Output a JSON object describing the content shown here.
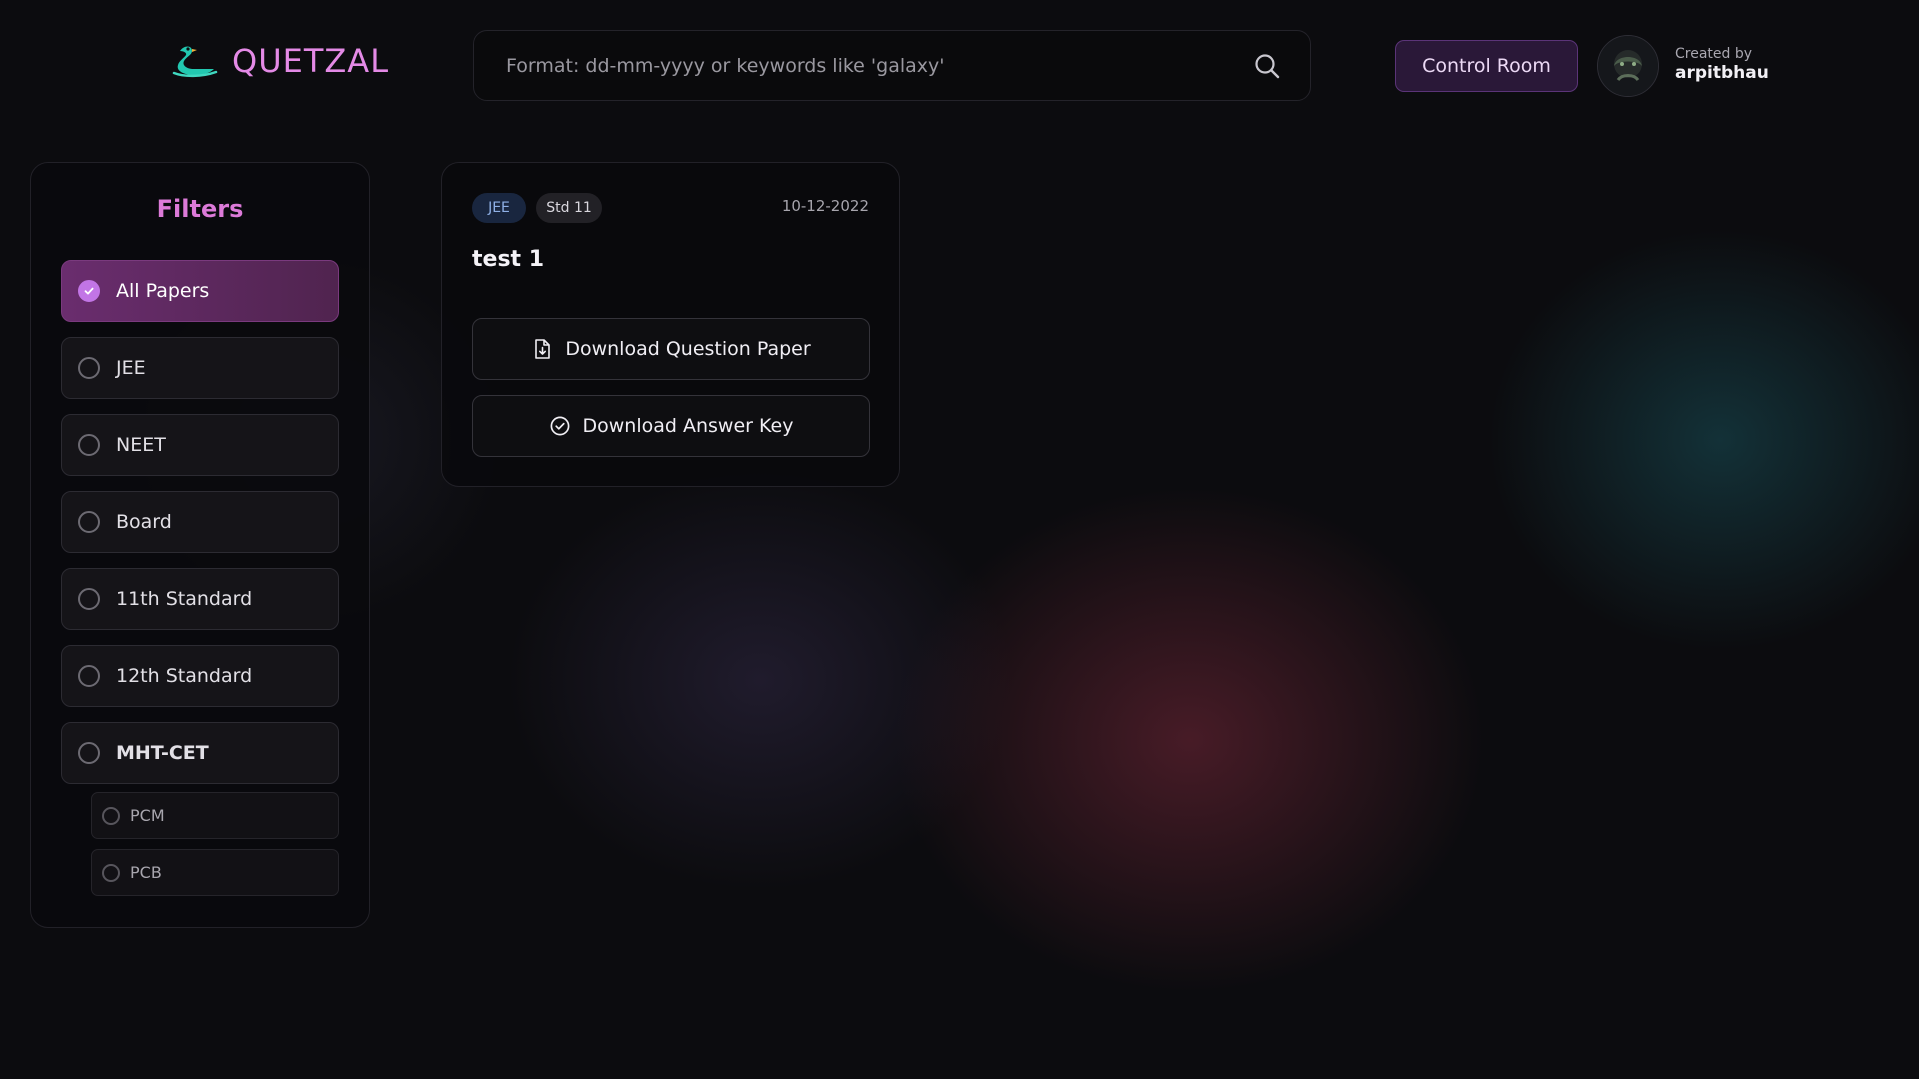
{
  "header": {
    "brand": "QUETZAL",
    "search": {
      "placeholder": "Format: dd-mm-yyyy or keywords like 'galaxy'",
      "value": ""
    },
    "control_button": "Control Room",
    "creator": {
      "caption": "Created by",
      "name": "arpitbhau"
    }
  },
  "filters": {
    "title": "Filters",
    "items": [
      {
        "label": "All Papers",
        "selected": true
      },
      {
        "label": "JEE",
        "selected": false
      },
      {
        "label": "NEET",
        "selected": false
      },
      {
        "label": "Board",
        "selected": false
      },
      {
        "label": "11th Standard",
        "selected": false
      },
      {
        "label": "12th Standard",
        "selected": false
      },
      {
        "label": "MHT-CET",
        "selected": false
      }
    ],
    "sub_items": [
      {
        "label": "PCM",
        "selected": false
      },
      {
        "label": "PCB",
        "selected": false
      }
    ]
  },
  "papers": [
    {
      "tags": [
        "JEE",
        "Std 11"
      ],
      "date": "10-12-2022",
      "title": "test 1",
      "question_button": "Download Question Paper",
      "answer_button": "Download Answer Key"
    }
  ],
  "colors": {
    "brand": "#e48ae6",
    "accent": "#c275e6",
    "active_filter": "#6a2d6e",
    "control_button_bg": "#2a1838"
  }
}
